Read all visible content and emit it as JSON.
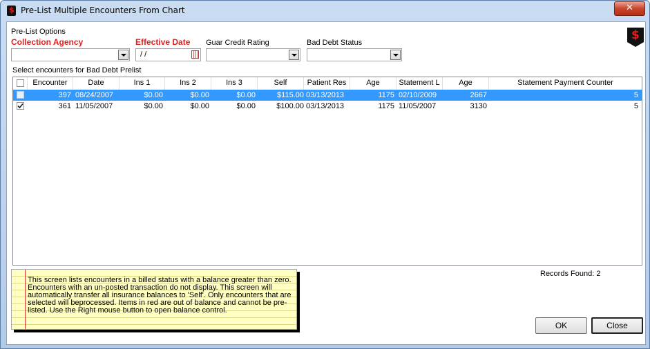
{
  "window": {
    "title": "Pre-List Multiple Encounters From Chart",
    "close_glyph": "✕"
  },
  "options": {
    "section_label": "Pre-List Options",
    "collection_agency_label": "Collection Agency",
    "collection_agency_value": "",
    "effective_date_label": "Effective Date",
    "effective_date_value": " / /",
    "guar_credit_label": "Guar Credit Rating",
    "guar_credit_value": "",
    "bad_debt_label": "Bad Debt Status",
    "bad_debt_value": ""
  },
  "logo": {
    "glyph": "$",
    "icon": "dollar-shield-icon"
  },
  "grid": {
    "section_label": "Select encounters for Bad Debt Prelist",
    "columns": [
      "Encounter",
      "Date",
      "Ins 1",
      "Ins 2",
      "Ins 3",
      "Self",
      "Patient Res",
      "Age",
      "Statement L",
      "Age",
      "Statement Payment Counter"
    ],
    "rows": [
      {
        "checked": false,
        "selected": true,
        "cells": [
          "397",
          "08/24/2007",
          "$0.00",
          "$0.00",
          "$0.00",
          "$115.00",
          "03/13/2013",
          "1175",
          "02/10/2009",
          "2667",
          "5"
        ]
      },
      {
        "checked": true,
        "selected": false,
        "cells": [
          "361",
          "11/05/2007",
          "$0.00",
          "$0.00",
          "$0.00",
          "$100.00",
          "03/13/2013",
          "1175",
          "11/05/2007",
          "3130",
          "5"
        ]
      }
    ]
  },
  "note": {
    "lines": [
      "This screen lists encounters in a billed status with a balance greater than zero.",
      "Encounters with an un-posted transaction do not display.  This screen will",
      "automatically transfer all insurance balances to 'Self'.  Only encounters that are",
      "selected will beprocessed.  Items in red are out of balance and cannot be pre-",
      "listed.  Use the Right mouse button to open balance control."
    ]
  },
  "records_found": "Records Found: 2",
  "buttons": {
    "ok": "OK",
    "close": "Close"
  },
  "colors": {
    "selection": "#3399ff",
    "required_label": "#e31e1e"
  }
}
